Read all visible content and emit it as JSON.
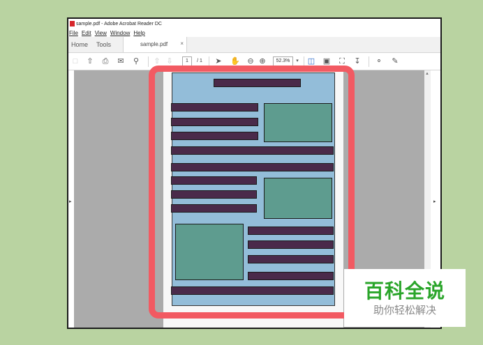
{
  "window": {
    "title": "sample.pdf - Adobe Acrobat Reader DC"
  },
  "menu": [
    "File",
    "Edit",
    "View",
    "Window",
    "Help"
  ],
  "tabs": {
    "home": "Home",
    "tools": "Tools",
    "document": "sample.pdf",
    "close_symbol": "×"
  },
  "toolbar": {
    "page_current": "1",
    "page_total": "/ 1",
    "zoom": "52.3%",
    "icons": [
      "create-pdf-icon",
      "upload-icon",
      "print-icon",
      "email-icon",
      "search-icon",
      "page-up-icon",
      "page-down-icon",
      "select-cursor-icon",
      "hand-tool-icon",
      "zoom-out-icon",
      "zoom-in-icon",
      "zoom-dropdown-icon",
      "fit-page-icon",
      "page-scroll-icon",
      "fullscreen-icon",
      "download-icon",
      "comment-icon",
      "sign-icon"
    ]
  },
  "colors": {
    "background": "#b9d3a1",
    "highlight": "#f25a62",
    "content_area": "#93bdd9",
    "text_block": "#4a2a4a",
    "image_block": "#5e9c8f"
  },
  "watermark": {
    "title": "百科全说",
    "subtitle": "助你轻松解决"
  }
}
